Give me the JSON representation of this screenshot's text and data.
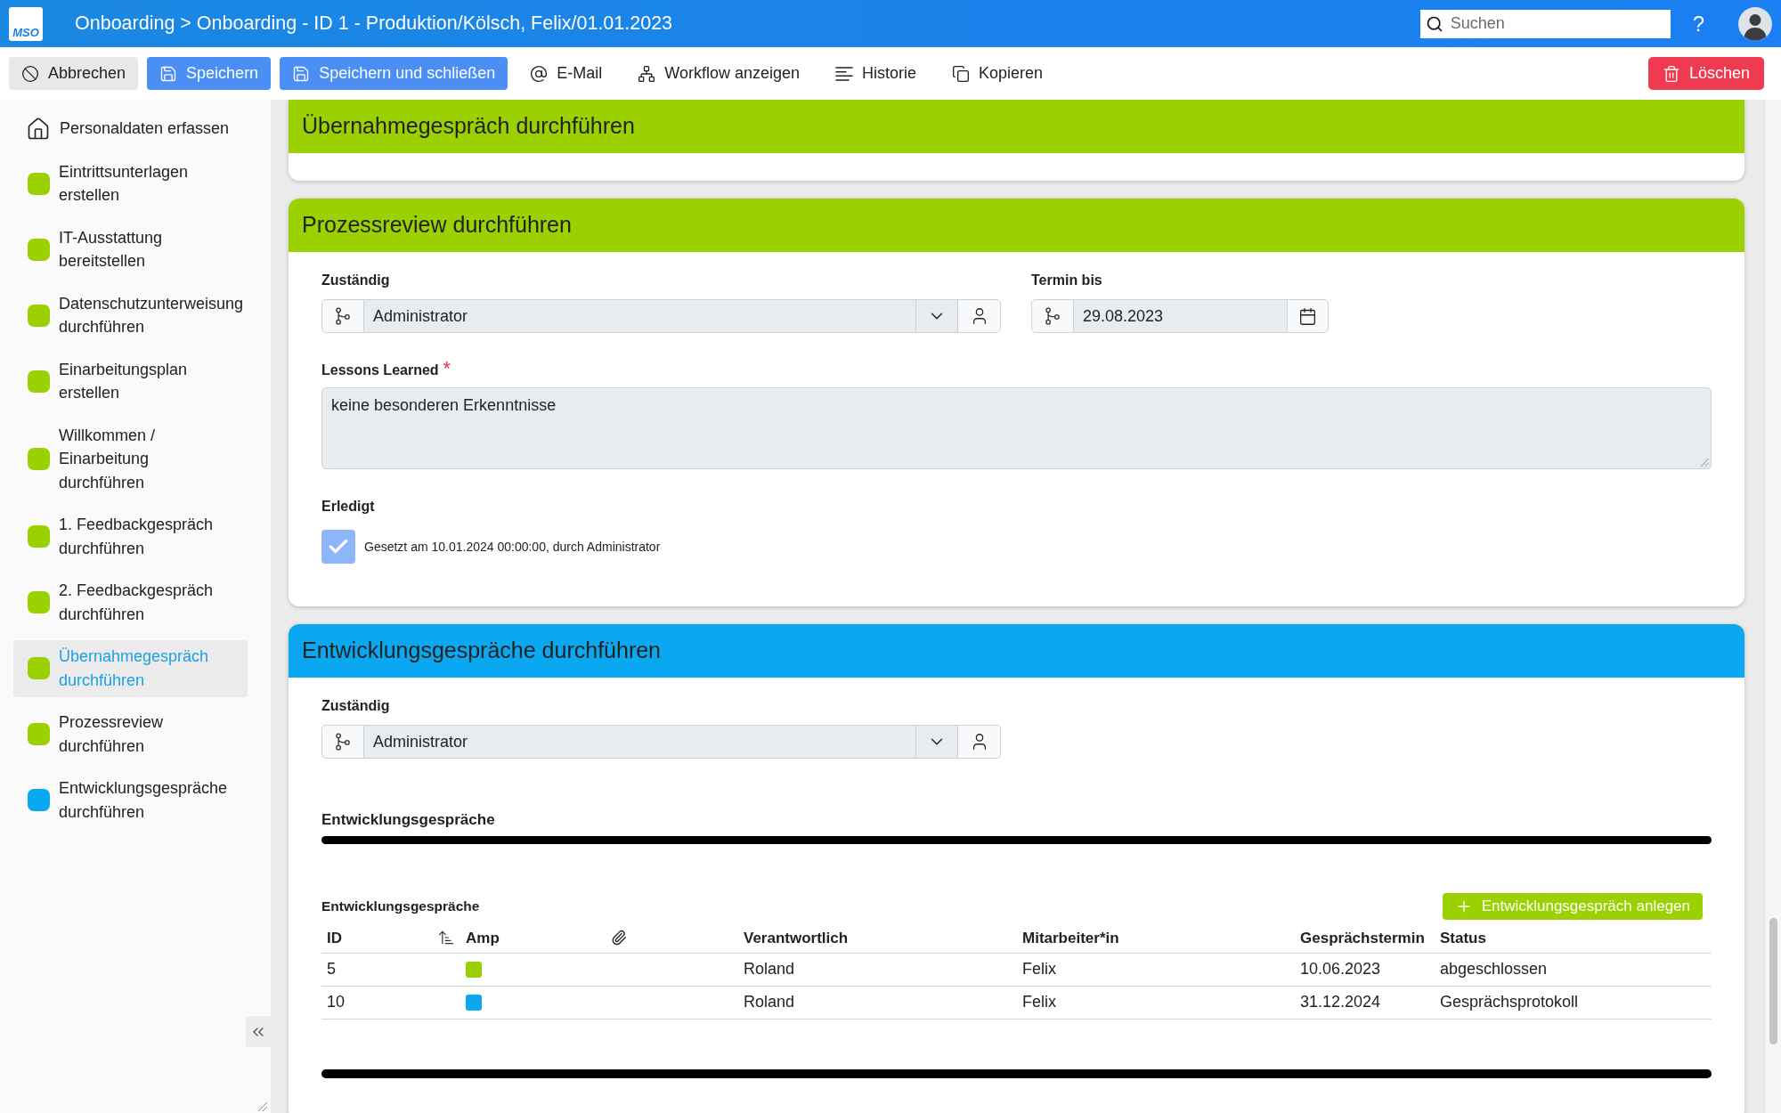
{
  "header": {
    "logo": "MSO",
    "title": "Onboarding > Onboarding - ID 1 - Produktion/Kölsch, Felix/01.01.2023",
    "search": {
      "placeholder": "Suchen"
    },
    "help": "?"
  },
  "toolbar": {
    "buttons": [
      {
        "kind": "cancel",
        "label": "Abbrechen"
      },
      {
        "kind": "save",
        "label": "Speichern"
      },
      {
        "kind": "save_close",
        "label": "Speichern und schließen"
      },
      {
        "kind": "email",
        "label": "E-Mail"
      },
      {
        "kind": "workflow",
        "label": "Workflow anzeigen"
      },
      {
        "kind": "history",
        "label": "Historie"
      },
      {
        "kind": "copy",
        "label": "Kopieren"
      },
      {
        "kind": "delete",
        "label": "Löschen"
      }
    ]
  },
  "sidebar": {
    "items": [
      {
        "kind": "home",
        "label": "Personaldaten erfassen",
        "selected": false
      },
      {
        "kind": "step",
        "label": "Eintrittsunterlagen erstellen",
        "color": "#9bd100",
        "selected": false
      },
      {
        "kind": "step",
        "label": "IT-Ausstattung bereitstellen",
        "color": "#9bd100",
        "selected": false
      },
      {
        "kind": "step",
        "label": "Datenschutzunterweisung durchführen",
        "color": "#9bd100",
        "selected": false
      },
      {
        "kind": "step",
        "label": "Einarbeitungsplan erstellen",
        "color": "#9bd100",
        "selected": false
      },
      {
        "kind": "step",
        "label": "Willkommen / Einarbeitung durchführen",
        "color": "#9bd100",
        "selected": false
      },
      {
        "kind": "step",
        "label": "1. Feedbackgespräch durchführen",
        "color": "#9bd100",
        "selected": false
      },
      {
        "kind": "step",
        "label": "2. Feedbackgespräch durchführen",
        "color": "#9bd100",
        "selected": false
      },
      {
        "kind": "step",
        "label": "Übernahmegespräch durchführen",
        "color": "#9bd100",
        "selected": true
      },
      {
        "kind": "step",
        "label": "Prozessreview durchführen",
        "color": "#9bd100",
        "selected": false
      },
      {
        "kind": "step",
        "label": "Entwicklungsgespräche durchführen",
        "color": "#0aa8f0",
        "selected": false
      }
    ]
  },
  "sections": [
    {
      "title": "Übernahmegespräch durchführen",
      "color": "#9bd100"
    },
    {
      "title": "Prozessreview durchführen",
      "color": "#9bd100",
      "fields": [
        {
          "kind": "assignee",
          "label": "Zuständig",
          "value": "Administrator"
        },
        {
          "kind": "date",
          "label": "Termin bis",
          "value": "29.08.2023"
        },
        {
          "kind": "textarea",
          "label": "Lessons Learned",
          "required_mark": "*",
          "value": "keine besonderen Erkenntnisse"
        },
        {
          "kind": "checkbox",
          "label": "Erledigt",
          "checked": true,
          "disabled": true,
          "note": "Gesetzt am 10.01.2024 00:00:00, durch Administrator"
        }
      ]
    },
    {
      "title": "Entwicklungsgespräche durchführen",
      "color": "#0aa8f0",
      "fields": [
        {
          "kind": "assignee",
          "label": "Zuständig",
          "value": "Administrator"
        },
        {
          "kind": "heading",
          "label": "Entwicklungsgespräche"
        },
        {
          "kind": "table",
          "title": "Entwicklungsgespräche",
          "add_button": "Entwicklungsgespräch anlegen",
          "columns": [
            {
              "kind": "text",
              "label": "ID",
              "sorted": true
            },
            {
              "kind": "swatch",
              "label": "Amp",
              "sorted": false
            },
            {
              "kind": "attachment",
              "sorted": false
            },
            {
              "kind": "text",
              "label": "Verantwortlich",
              "sorted": false
            },
            {
              "kind": "text",
              "label": "Mitarbeiter*in",
              "sorted": false
            },
            {
              "kind": "text",
              "label": "Gesprächstermin",
              "sorted": false
            },
            {
              "kind": "text",
              "label": "Status",
              "sorted": false
            }
          ],
          "rows": [
            {
              "color": "#9bd100",
              "cells": [
                "5",
                "",
                "",
                "Roland",
                "Felix",
                "10.06.2023",
                "abgeschlossen"
              ]
            },
            {
              "color": "#0aa8f0",
              "cells": [
                "10",
                "",
                "",
                "Roland",
                "Felix",
                "31.12.2024",
                "Gesprächsprotokoll"
              ]
            }
          ]
        }
      ]
    }
  ]
}
